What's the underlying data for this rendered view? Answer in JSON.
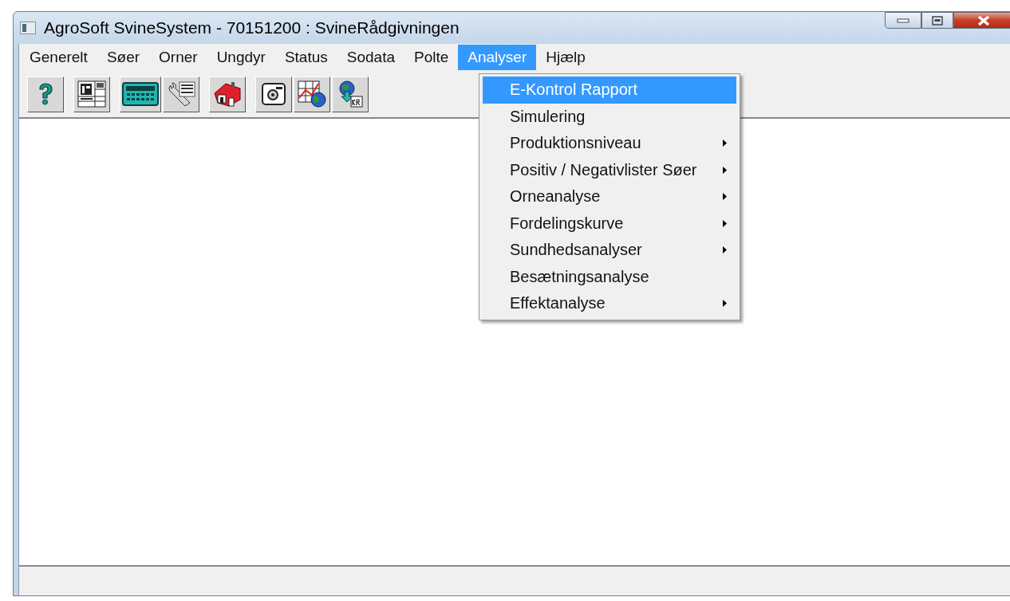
{
  "window": {
    "title": "AgroSoft SvineSystem - 70151200 : SvineRådgivningen"
  },
  "menu": [
    {
      "label": "Generelt",
      "selected": false
    },
    {
      "label": "Søer",
      "selected": false
    },
    {
      "label": "Orner",
      "selected": false
    },
    {
      "label": "Ungdyr",
      "selected": false
    },
    {
      "label": "Status",
      "selected": false
    },
    {
      "label": "Sodata",
      "selected": false
    },
    {
      "label": "Polte",
      "selected": false
    },
    {
      "label": "Analyser",
      "selected": true
    },
    {
      "label": "Hjælp",
      "selected": false
    }
  ],
  "toolbar_groups": [
    {
      "buttons": [
        {
          "kind": "help"
        }
      ]
    },
    {
      "buttons": [
        {
          "kind": "calendar"
        }
      ]
    },
    {
      "buttons": [
        {
          "kind": "calculator"
        },
        {
          "kind": "setup"
        }
      ]
    },
    {
      "buttons": [
        {
          "kind": "house"
        }
      ]
    },
    {
      "buttons": [
        {
          "kind": "safe"
        },
        {
          "kind": "chart"
        },
        {
          "kind": "globe"
        }
      ]
    }
  ],
  "dropdown": [
    {
      "label": "E-Kontrol Rapport",
      "selected": true,
      "submenu": false
    },
    {
      "label": "Simulering",
      "selected": false,
      "submenu": false
    },
    {
      "label": "Produktionsniveau",
      "selected": false,
      "submenu": true
    },
    {
      "label": "Positiv / Negativlister Søer",
      "selected": false,
      "submenu": true
    },
    {
      "label": "Orneanalyse",
      "selected": false,
      "submenu": true
    },
    {
      "label": "Fordelingskurve",
      "selected": false,
      "submenu": true
    },
    {
      "label": "Sundhedsanalyser",
      "selected": false,
      "submenu": true
    },
    {
      "label": "Besætningsanalyse",
      "selected": false,
      "submenu": false
    },
    {
      "label": "Effektanalyse",
      "selected": false,
      "submenu": true
    }
  ]
}
